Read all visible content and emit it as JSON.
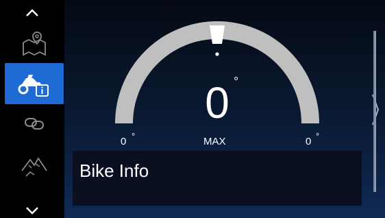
{
  "sidebar": {
    "up_icon": "chevron-up-icon",
    "down_icon": "chevron-down-icon",
    "items": [
      {
        "name": "map",
        "icon": "map-pin-icon",
        "active": false
      },
      {
        "name": "bike-info",
        "icon": "motorcycle-info-icon",
        "active": true
      },
      {
        "name": "connectivity",
        "icon": "link-icon",
        "active": false
      },
      {
        "name": "terrain",
        "icon": "mountain-icon",
        "active": false
      }
    ]
  },
  "gauge": {
    "value": "0",
    "unit_symbol": "°",
    "left_value": "0",
    "left_unit": "°",
    "right_value": "0",
    "right_unit": "°",
    "center_label": "MAX"
  },
  "panel": {
    "title": "Bike Info"
  },
  "colors": {
    "accent": "#1e6bd6",
    "gauge_track": "#bfbfbf",
    "background_top": "#050a14",
    "background_bottom": "#0f2a55"
  }
}
